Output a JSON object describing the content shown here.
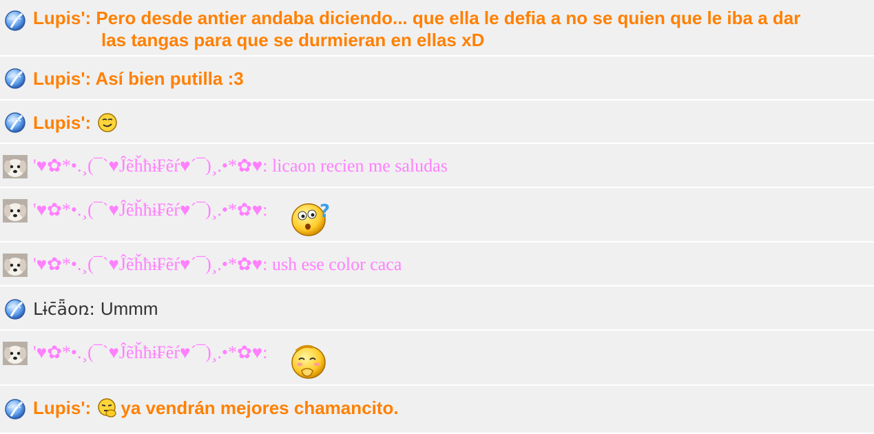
{
  "messages": [
    {
      "sender": "Lupis'",
      "text_line1": "Pero desde antier andaba diciendo... que ella le defia a no se quien que le iba a dar",
      "text_line2": "las tangas para que se durmieran en ellas xD"
    },
    {
      "sender": "Lupis'",
      "text": "Así bien putilla :3"
    },
    {
      "sender": "Lupis'",
      "emoticon": "smirk-smiley-icon"
    },
    {
      "sender": "'♥✿*•.¸(¯`♥Ĵẽȟħɨ₣ẽŕ♥´¯)¸.•*✿♥",
      "text": "licaon recien me saludas"
    },
    {
      "sender": "'♥✿*•.¸(¯`♥Ĵẽȟħɨ₣ẽŕ♥´¯)¸.•*✿♥",
      "emoticon": "confused-question-emoticon"
    },
    {
      "sender": "'♥✿*•.¸(¯`♥Ĵẽȟħɨ₣ẽŕ♥´¯)¸.•*✿♥",
      "text": "ush ese color caca"
    },
    {
      "sender": "Lɨc̄ǟoռ",
      "text": "Ummm"
    },
    {
      "sender": "'♥✿*•.¸(¯`♥Ĵẽȟħɨ₣ẽŕ♥´¯)¸.•*✿♥",
      "emoticon": "giggle-emoticon"
    },
    {
      "sender": "Lupis'",
      "emoticon": "thinking-emoticon",
      "text": "ya vendrán mejores chamancito."
    }
  ],
  "colors": {
    "orange": "#ff8000",
    "pink": "#ff80ff",
    "dark": "#333333",
    "row_bg": "#f0f0f0",
    "separator": "#ffffff"
  }
}
